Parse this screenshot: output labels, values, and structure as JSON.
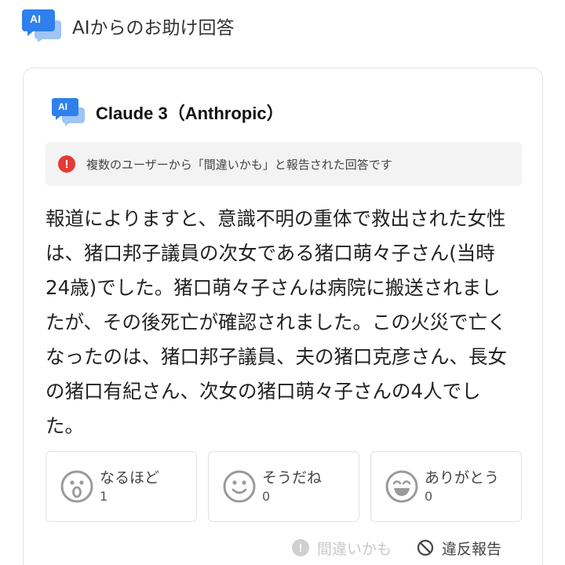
{
  "header": {
    "icon": "ai-chat-icon",
    "icon_text": "AI",
    "title": "AIからのお助け回答"
  },
  "card": {
    "model_icon": "ai-chat-icon",
    "model_icon_text": "AI",
    "model_name": "Claude 3（Anthropic）",
    "notice": {
      "icon": "exclamation-icon",
      "icon_text": "!",
      "text": "複数のユーザーから「間違いかも」と報告された回答です"
    },
    "answer": "報道によりますと、意識不明の重体で救出された女性は、猪口邦子議員の次女である猪口萌々子さん(当時24歳)でした。猪口萌々子さんは病院に搬送されましたが、その後死亡が確認されました。この火災で亡くなったのは、猪口邦子議員、夫の猪口克彦さん、長女の猪口有紀さん、次女の猪口萌々子さんの4人でした。",
    "reactions": [
      {
        "icon": "surprised-face-icon",
        "label": "なるほど",
        "count": "1"
      },
      {
        "icon": "smile-face-icon",
        "label": "そうだね",
        "count": "0"
      },
      {
        "icon": "grin-face-icon",
        "label": "ありがとう",
        "count": "0"
      }
    ],
    "footer": {
      "wrong_icon_text": "!",
      "wrong_label": "間違いかも",
      "report_label": "違反報告"
    }
  },
  "colors": {
    "accent_blue": "#2f80ed",
    "light_blue": "#9ec5f3",
    "alert_red": "#e53935",
    "face_gray": "#9a9a9a"
  }
}
